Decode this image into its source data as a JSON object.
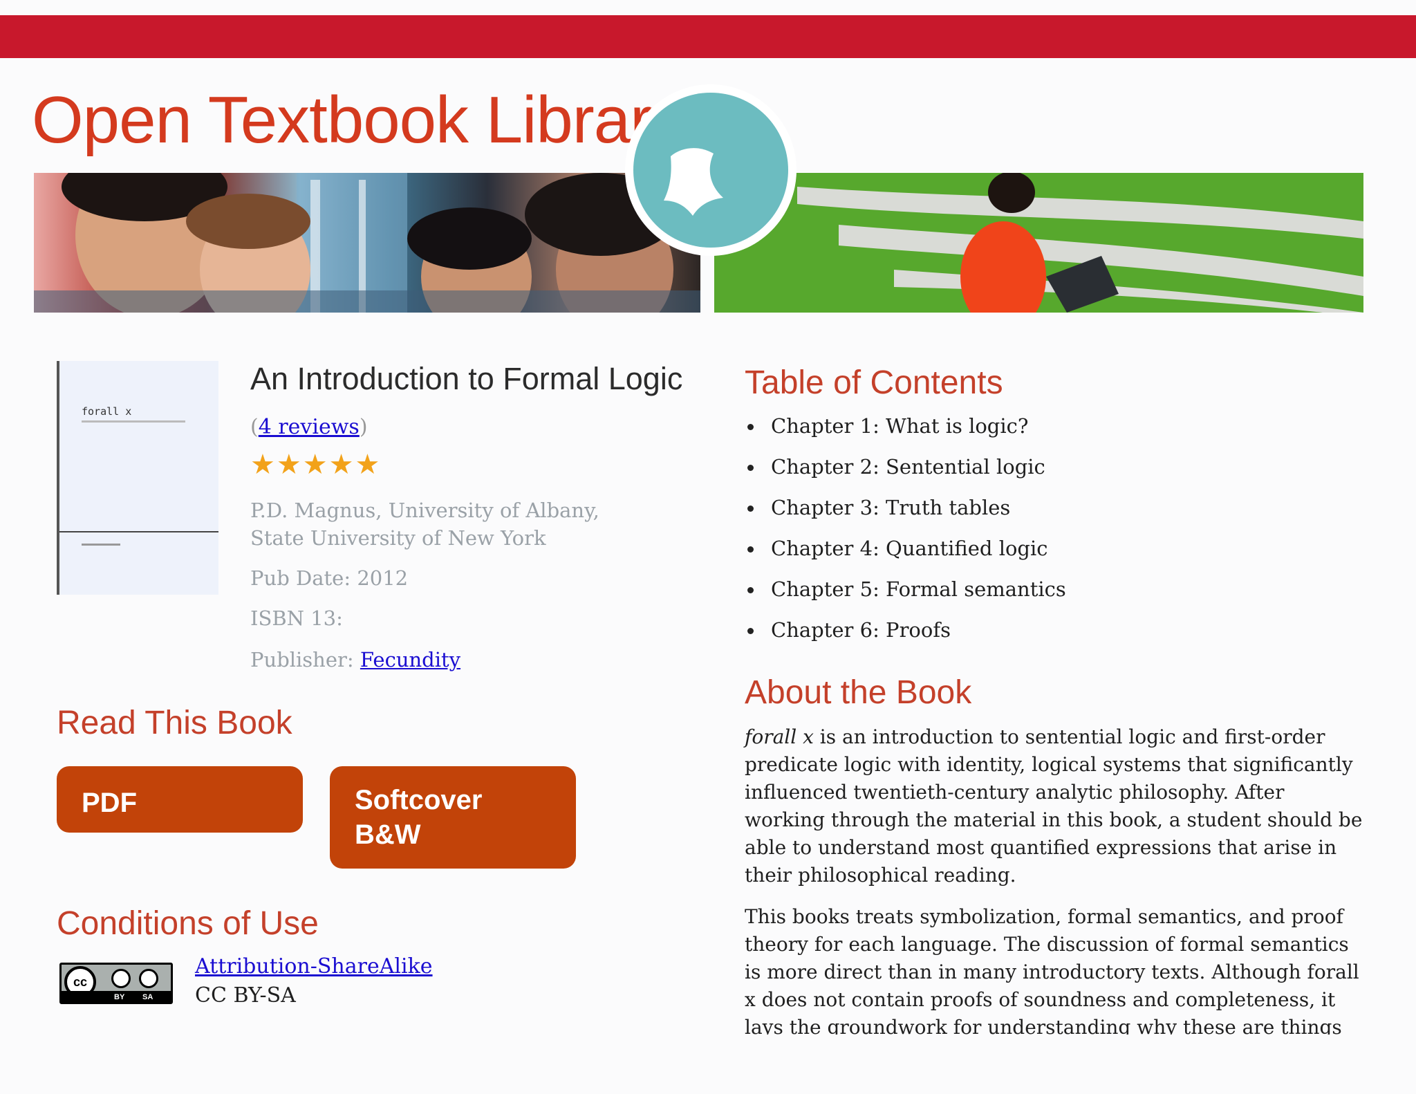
{
  "site": {
    "title": "Open Textbook Library"
  },
  "book": {
    "title": "An Introduction to Formal Logic",
    "reviews_open": "(",
    "reviews_link": "4 reviews",
    "reviews_close": ")",
    "rating": 5,
    "rating_max": 5,
    "authors": "P.D. Magnus, University of Albany, State University of New York",
    "pub_date": "Pub Date: 2012",
    "isbn": "ISBN 13:",
    "publisher_label": "Publisher:",
    "publisher": "Fecundity",
    "cover_title": "forall x"
  },
  "read": {
    "heading": "Read This Book",
    "buttons": [
      {
        "label": "PDF"
      },
      {
        "label": "Softcover B&W"
      }
    ]
  },
  "conditions": {
    "heading": "Conditions of Use",
    "badge": {
      "cc": "cc",
      "by": "BY",
      "sa": "SA"
    },
    "license_link": "Attribution-ShareAlike",
    "license_code": "CC BY-SA"
  },
  "toc": {
    "heading": "Table of Contents",
    "items": [
      "Chapter 1: What is logic?",
      "Chapter 2: Sentential logic",
      "Chapter 3: Truth tables",
      "Chapter 4: Quantified logic",
      "Chapter 5: Formal semantics",
      "Chapter 6: Proofs"
    ]
  },
  "about": {
    "heading": "About the Book",
    "p1_em": "forall x",
    "p1": " is an introduction to sentential logic and first-order predicate logic with identity, logical systems that significantly influenced twentieth-century analytic philosophy. After working through the material in this book, a student should be able to understand most quantified expressions that arise in their philosophical reading.",
    "p2": "This books treats symbolization, formal semantics, and proof theory for each language. The discussion of formal semantics is more direct than in many introductory texts. Although forall x does not contain proofs of soundness and completeness, it lays the groundwork for understanding why these are things that need"
  },
  "colors": {
    "top_bar": "#c8182c",
    "accent": "#c4402a",
    "button": "#c24309",
    "logo": "#6cbcc0",
    "star": "#f2a21a",
    "link": "#1a0dd1"
  }
}
